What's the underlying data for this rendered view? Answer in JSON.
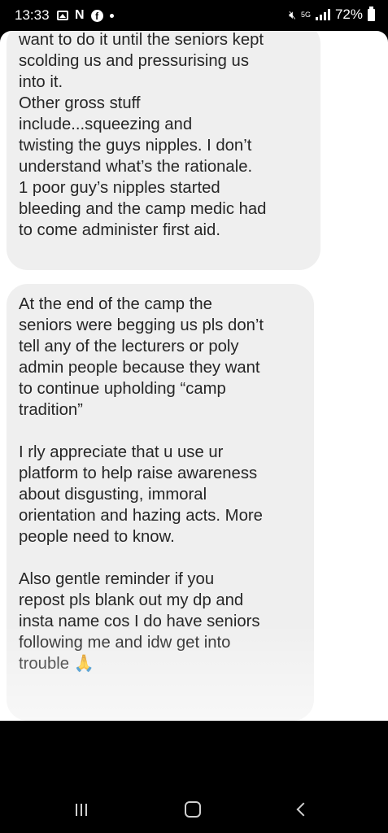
{
  "status_bar": {
    "time": "13:33",
    "left_icons": [
      "gallery-icon",
      "netflix-icon",
      "facebook-icon",
      "notification-dot-icon"
    ],
    "network": "5G",
    "battery": "72%"
  },
  "messages": [
    {
      "lines": [
        "want to do it until the seniors kept",
        "scolding us and pressurising us",
        "into it.",
        "Other gross stuff",
        "include...squeezing and",
        "twisting the guys nipples. I don’t",
        "understand what’s the rationale.",
        "1 poor guy’s nipples started",
        "bleeding and the camp medic had",
        "to come administer first aid."
      ]
    },
    {
      "paragraph1": [
        "At the end of the camp the",
        "seniors were begging us pls don’t",
        "tell any of the lecturers or poly",
        "admin people because they want",
        "to continue upholding “camp",
        "tradition”"
      ],
      "paragraph2": [
        "I rly appreciate that u use ur",
        "platform to help raise awareness",
        "about disgusting, immoral",
        "orientation and hazing acts. More",
        "people need to know."
      ],
      "paragraph3": [
        "Also gentle reminder if you",
        "repost pls blank out my dp and",
        "insta name cos I do have seniors",
        "following me and idw get into",
        "trouble"
      ],
      "emoji": "🙏"
    }
  ],
  "nav_bar": {
    "buttons": [
      "recents-icon",
      "home-icon",
      "back-icon"
    ]
  }
}
